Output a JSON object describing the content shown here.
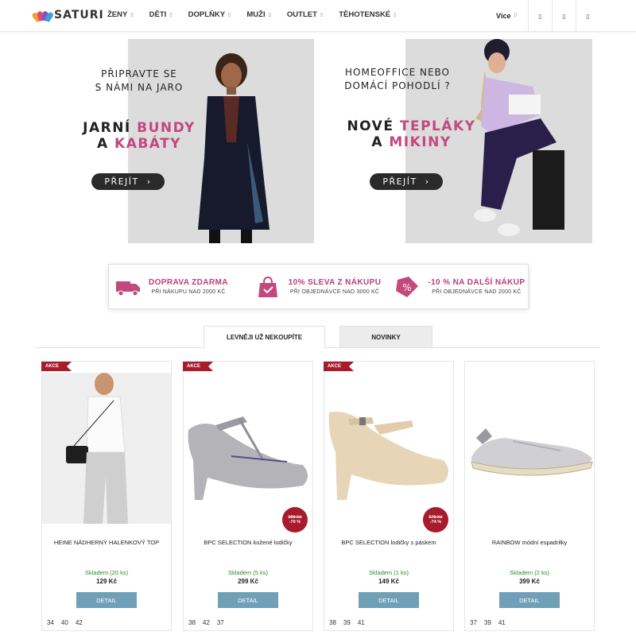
{
  "header": {
    "logo": "SATURI",
    "nav": [
      "ŽENY",
      "DĚTI",
      "DOPLŇKY",
      "MUŽI",
      "OUTLET",
      "TĚHOTENSKÉ"
    ],
    "more_label": "Více",
    "icons": [
      "search-icon",
      "user-icon",
      "cart-icon"
    ]
  },
  "banners": [
    {
      "small_line1": "PŘIPRAVTE SE",
      "small_line2": "S NÁMI NA JARO",
      "big_a": "JARNÍ ",
      "big_b": "BUNDY",
      "big_c": "A ",
      "big_d": "KABÁTY",
      "button": "PŘEJÍT"
    },
    {
      "small_line1": "HOMEOFFICE NEBO",
      "small_line2": "DOMÁCÍ POHODLÍ ?",
      "big_a": "NOVÉ ",
      "big_b": "TEPLÁKY",
      "big_c": "A ",
      "big_d": "MIKINY",
      "button": "PŘEJÍT"
    }
  ],
  "benefits": [
    {
      "title": "DOPRAVA ZDARMA",
      "subtitle": "PŘI NÁKUPU NAD 2000 KČ",
      "icon": "truck-icon"
    },
    {
      "title": "10% SLEVA Z NÁKUPU",
      "subtitle": "PŘI OBJEDNÁVCE NAD 3000 KČ",
      "icon": "bag-icon"
    },
    {
      "title": "-10 % NA DALŠÍ NÁKUP",
      "subtitle": "PŘI OBJEDNÁVCE NAD 2000 KČ",
      "icon": "percent-tag-icon"
    }
  ],
  "tabs": [
    "LEVNĚJI UŽ NEKOUPÍTE",
    "NOVINKY"
  ],
  "products": [
    {
      "badge": "AKCE",
      "name": "HEINE NÁDHERNÝ HALENKOVÝ TOP",
      "stock": "Skladem (20 ks)",
      "price": "129 Kč",
      "button": "DETAIL",
      "sizes": [
        "34",
        "40",
        "42"
      ]
    },
    {
      "badge": "AKCE",
      "name": "BPC SELECTION kožené lodičky",
      "stock": "Skladem (5 ks)",
      "price": "299 Kč",
      "button": "DETAIL",
      "old_price": "999 Kč",
      "discount": "-70 %",
      "sizes": [
        "38",
        "42",
        "37"
      ]
    },
    {
      "badge": "AKCE",
      "name": "BPC SELECTION lodičky s páskem",
      "stock": "Skladem (1 ks)",
      "price": "149 Kč",
      "button": "DETAIL",
      "old_price": "579 Kč",
      "discount": "-74 %",
      "sizes": [
        "38",
        "39",
        "41"
      ]
    },
    {
      "name": "RAINBOW módní espadrilky",
      "stock": "Skladem (2 ks)",
      "price": "399 Kč",
      "button": "DETAIL",
      "sizes": [
        "37",
        "39",
        "41"
      ]
    }
  ],
  "colors": {
    "accent_pink": "#c2487e",
    "sale_red": "#a81b2c",
    "detail_button": "#6fa0b8",
    "stock_green": "#2e8b2e"
  }
}
